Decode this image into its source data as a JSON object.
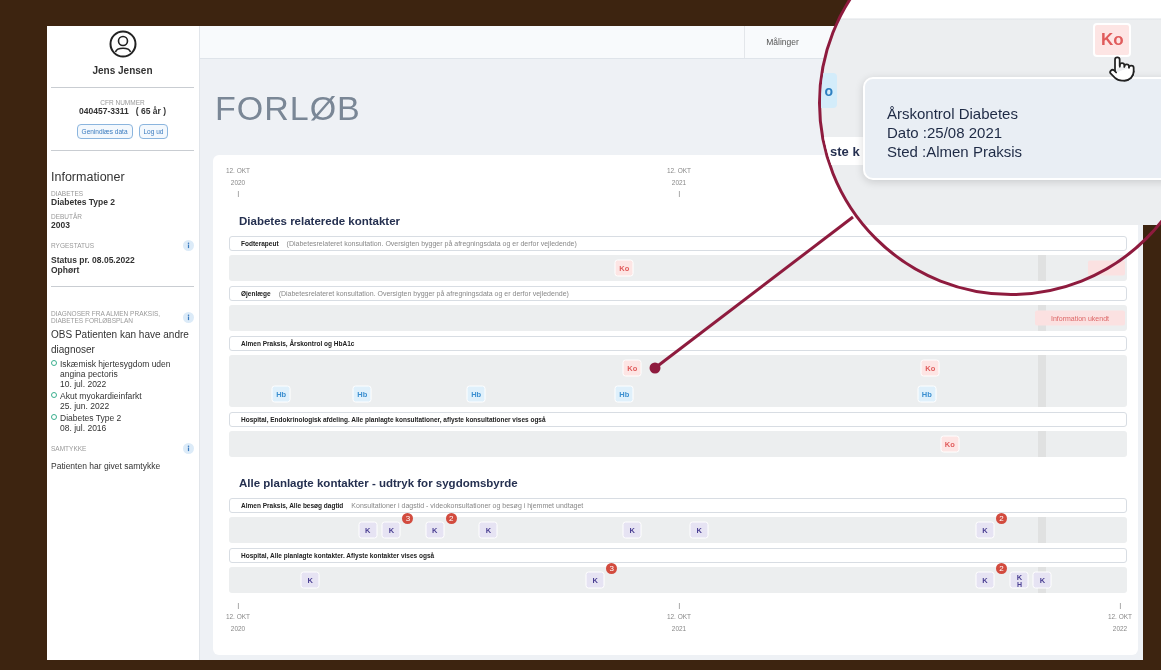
{
  "sidebar": {
    "name": "Jens Jensen",
    "cpr_label": "CFR NUMMER",
    "cpr_value": "040457-3311   ( 65 år )",
    "buttons": [
      "Genindlæs data",
      "Log ud"
    ],
    "heading": "Informationer",
    "fields": [
      {
        "label": "DIABETES",
        "value": "Diabetes Type 2"
      },
      {
        "label": "DEBUTÅR",
        "value": "2003"
      }
    ],
    "smoking": {
      "label": "RYGESTATUS",
      "lines": [
        "Status pr. 08.05.2022",
        "Ophørt"
      ]
    },
    "diagnoses": {
      "label": "DIAGNOSER FRA ALMEN PRAKSIS, DIABETES FORLØBSPLAN",
      "warning": "OBS Patienten kan have andre diagnoser",
      "items": [
        {
          "name": "Iskæmisk hjertesygdom uden angina pectoris",
          "date": "10. jul. 2022"
        },
        {
          "name": "Akut myokardieinfarkt",
          "date": "25. jun. 2022"
        },
        {
          "name": "Diabetes Type 2",
          "date": "08. jul. 2016"
        }
      ]
    },
    "consent": {
      "label": "SAMTYKKE",
      "text": "Patienten har givet samtykke"
    }
  },
  "topbar": {
    "tabs": [
      {
        "label": "Målinger"
      }
    ]
  },
  "title": "FORLØB",
  "timeline": {
    "top_ticks": [
      {
        "day": "12. OKT",
        "year": "2020"
      },
      {
        "day": "12. OKT",
        "year": "2021"
      }
    ],
    "bottom_ticks": [
      {
        "day": "12. OKT",
        "year": "2020"
      },
      {
        "day": "12. OKT",
        "year": "2021"
      },
      {
        "day": "12. OKT",
        "year": "2022"
      }
    ],
    "sections": [
      {
        "title": "Diabetes relaterede kontakter",
        "rows": [
          {
            "name": "Fodterapeut",
            "note": "(Diabetesrelateret konsultation. Oversigten bygger på afregningsdata og er derfor vejledende)",
            "flag": {
              "kind": "note"
            },
            "lanes": [
              [
                {
                  "kind": "ko",
                  "label": "Ko"
                }
              ]
            ]
          },
          {
            "name": "Øjenlæge",
            "note": "(Diabetesrelateret konsultation. Oversigten bygger på afregningsdata og er derfor vejledende)",
            "flag": {
              "kind": "note",
              "label": "Information ukendt"
            }
          },
          {
            "name": "Almen Praksis, Årskontrol og HbA1c",
            "lanes": [
              [
                {
                  "kind": "ko",
                  "label": "Ko"
                },
                {
                  "kind": "ko",
                  "label": "Ko"
                }
              ],
              [
                {
                  "kind": "hb",
                  "label": "Hb"
                },
                {
                  "kind": "hb",
                  "label": "Hb"
                },
                {
                  "kind": "hb",
                  "label": "Hb"
                },
                {
                  "kind": "hb",
                  "label": "Hb"
                },
                {
                  "kind": "hb",
                  "label": "Hb"
                }
              ]
            ]
          },
          {
            "name": "Hospital, Endokrinologisk afdeling. Alle planlagte konsultationer, aflyste konsultationer vises også",
            "lanes": [
              [
                {
                  "kind": "ko",
                  "label": "Ko"
                }
              ]
            ]
          }
        ]
      },
      {
        "title": "Alle planlagte kontakter - udtryk for sygdomsbyrde",
        "rows": [
          {
            "name": "Almen Praksis, Alle besøg dagtid",
            "note": "Konsultationer i dagstid - videokonsultationer og besøg i hjemmet undtaget",
            "lanes": [
              [
                {
                  "kind": "k",
                  "label": "K"
                },
                {
                  "kind": "k",
                  "label": "K",
                  "count": "3"
                },
                {
                  "kind": "k",
                  "label": "K",
                  "count": "2"
                },
                {
                  "kind": "k",
                  "label": "K"
                },
                {
                  "kind": "k",
                  "label": "K"
                },
                {
                  "kind": "k",
                  "label": "K"
                },
                {
                  "kind": "k",
                  "label": "K",
                  "count": "2"
                }
              ]
            ]
          },
          {
            "name": "Hospital, Alle planlagte kontakter. Aflyste kontakter vises også",
            "lanes": [
              [
                {
                  "kind": "k",
                  "label": "K"
                },
                {
                  "kind": "k",
                  "label": "K",
                  "count": "3"
                },
                {
                  "kind": "k",
                  "label": "K",
                  "count": "2"
                },
                {
                  "kind": "k",
                  "label": "K",
                  "sub": "H"
                },
                {
                  "kind": "k",
                  "label": "K"
                }
              ]
            ]
          }
        ]
      }
    ]
  },
  "magnifier": {
    "chip": {
      "kind": "ko",
      "label": "Ko"
    },
    "tooltip": [
      "Årskontrol Diabetes",
      "Dato :25/08 2021",
      "Sted :Almen Praksis"
    ],
    "fragments": [
      {
        "kind": "chip",
        "label": "o"
      },
      {
        "kind": "heading",
        "label": "ste k"
      }
    ]
  }
}
